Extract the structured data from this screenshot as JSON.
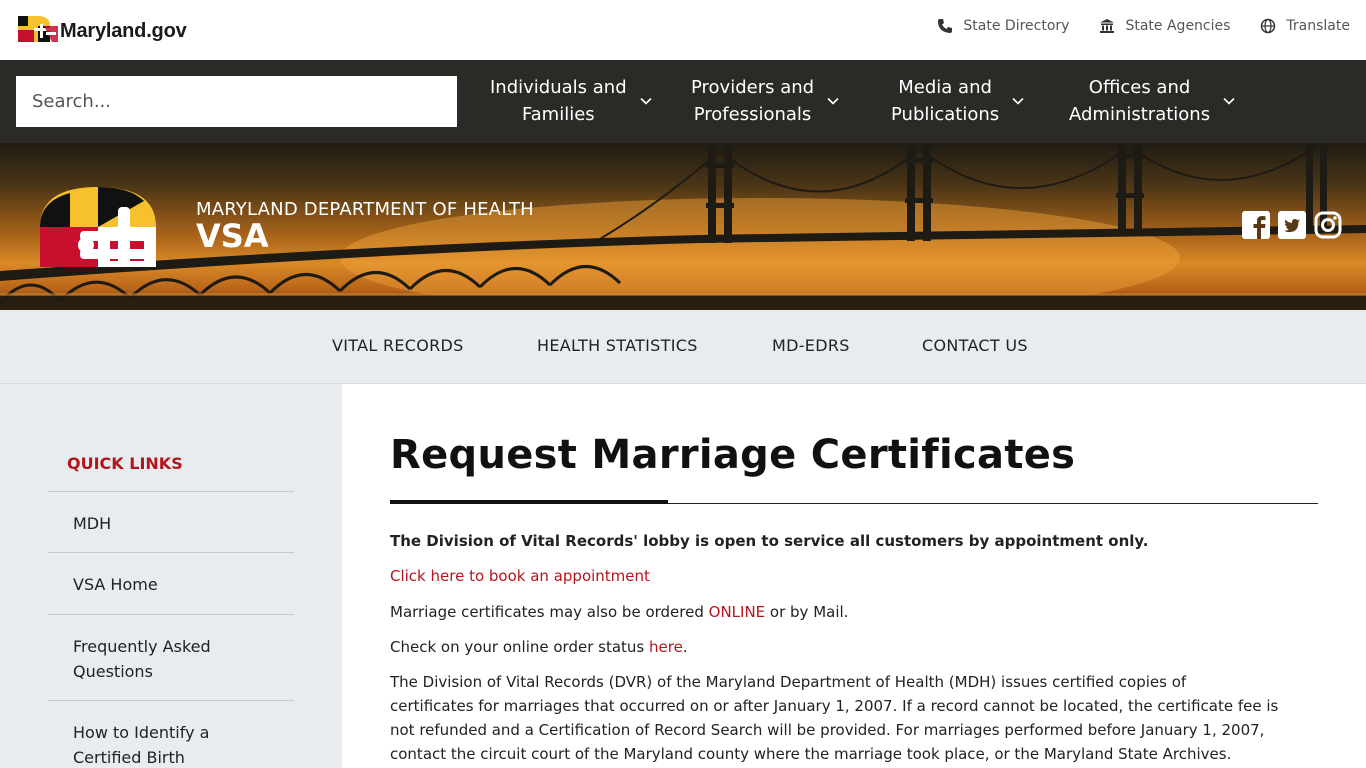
{
  "utility": {
    "brand": "Maryland.gov",
    "links": [
      {
        "label": "State Directory",
        "icon": "phone-icon"
      },
      {
        "label": "State Agencies",
        "icon": "bank-icon"
      },
      {
        "label": "Translate",
        "icon": "globe-icon"
      }
    ]
  },
  "mainnav": {
    "search_placeholder": "Search...",
    "items": [
      {
        "line1": "Individuals and",
        "line2": "Families"
      },
      {
        "line1": "Providers and",
        "line2": "Professionals"
      },
      {
        "line1": "Media and",
        "line2": "Publications"
      },
      {
        "line1": "Offices and",
        "line2": "Administrations"
      }
    ]
  },
  "banner": {
    "department": "MARYLAND DEPARTMENT OF HEALTH",
    "unit": "VSA",
    "social": [
      "facebook-icon",
      "twitter-icon",
      "instagram-icon"
    ]
  },
  "subnav": {
    "items": [
      "VITAL RECORDS",
      "HEALTH STATISTICS",
      "MD-EDRS",
      "CONTACT US"
    ]
  },
  "sidebar": {
    "title": "QUICK LINKS",
    "items": [
      {
        "line1": "MDH",
        "line2": ""
      },
      {
        "line1": "VSA Home",
        "line2": ""
      },
      {
        "line1": "Frequently Asked",
        "line2": "Questions"
      },
      {
        "line1": "How to Identify a",
        "line2": "Certified Birth"
      }
    ]
  },
  "content": {
    "title": "Request Marriage Certificates",
    "lobby_notice": "The Division of Vital Records' lobby is open to service all customers by appointment only.",
    "appointment_link": "Click here to book an appointment",
    "order_pre": "Marriage certificates may also be ordered ",
    "order_link": "ONLINE",
    "order_post": " or by Mail.",
    "status_pre": "Check on your online order status ",
    "status_link": "here",
    "status_post": ".",
    "body_lines": [
      "The Division of Vital Records (DVR) of the Maryland Department of Health (MDH) issues certified copies of",
      "certificates for marriages that occurred on or after January 1, 2007. If a record cannot be located, the certificate fee is",
      "not refunded and a Certification of Record Search will be provided. For marriages performed before January 1, 2007,",
      "contact the circuit court of the Maryland county where the marriage took place, or the Maryland State Archives."
    ]
  },
  "colors": {
    "accent_red": "#b3151c",
    "nav_dark": "#2b2a27",
    "sidebar_gray": "#e9ecef",
    "flag_gold": "#f6c12d",
    "flag_red": "#c8102e"
  }
}
